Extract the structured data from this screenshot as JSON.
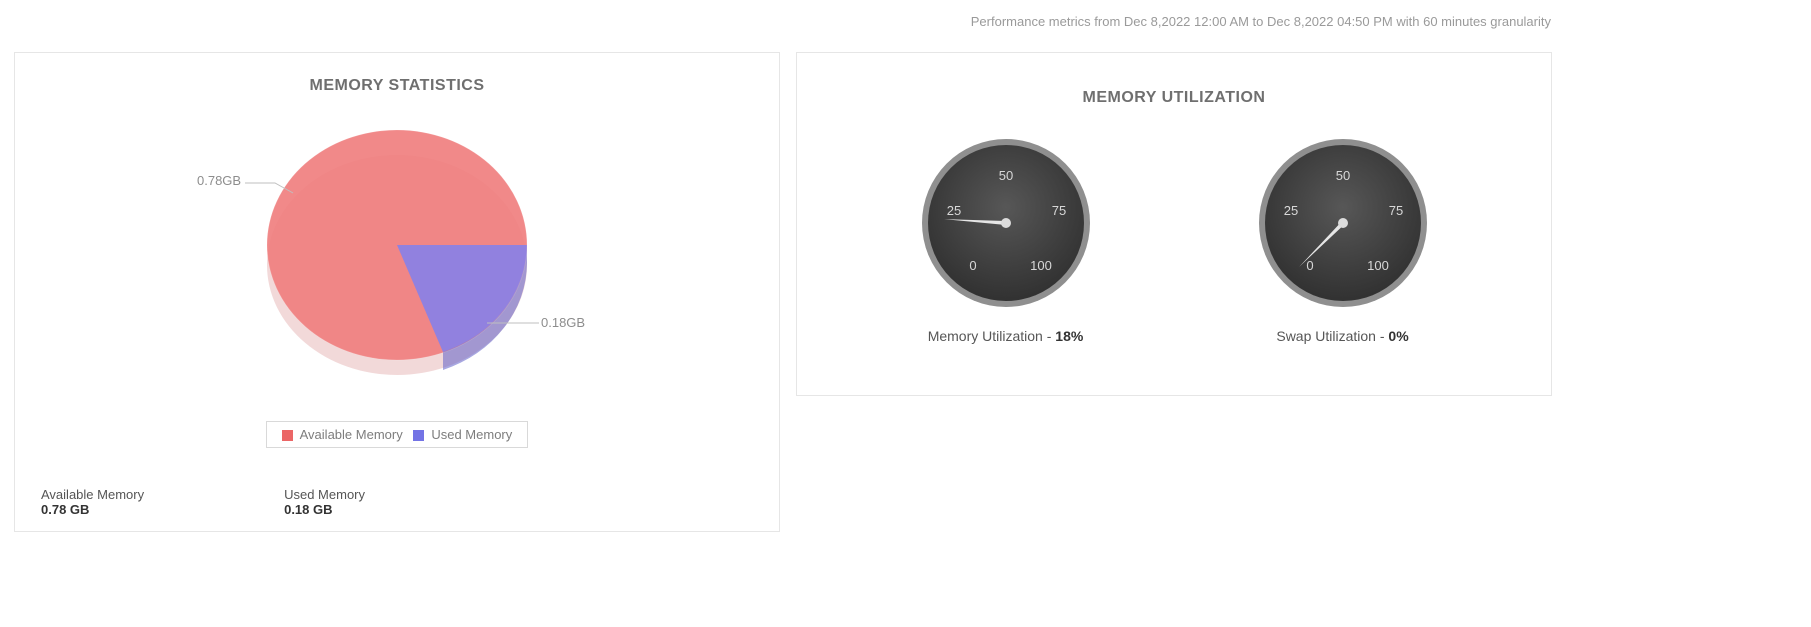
{
  "header": {
    "metrics_line": "Performance metrics from Dec 8,2022 12:00 AM to Dec 8,2022 04:50 PM with 60 minutes granularity"
  },
  "memory_statistics": {
    "title": "MEMORY STATISTICS",
    "available_label": "Available Memory",
    "used_label": "Used Memory",
    "available_value": "0.78 GB",
    "used_value": "0.18 GB",
    "pie": {
      "available_slice_label": "0.78GB",
      "used_slice_label": "0.18GB"
    },
    "legend": {
      "available": "Available Memory",
      "used": "Used Memory"
    }
  },
  "memory_utilization": {
    "title": "MEMORY UTILIZATION",
    "mem_label_prefix": "Memory Utilization - ",
    "mem_value_display": "18%",
    "swap_label_prefix": "Swap Utilization - ",
    "swap_value_display": "0%",
    "gauge_ticks": {
      "t0": "0",
      "t25": "25",
      "t50": "50",
      "t75": "75",
      "t100": "100"
    }
  },
  "chart_data": [
    {
      "type": "pie",
      "title": "MEMORY STATISTICS",
      "series": [
        {
          "name": "Available Memory",
          "value": 0.78,
          "unit": "GB",
          "color": "#ef7c7c"
        },
        {
          "name": "Used Memory",
          "value": 0.18,
          "unit": "GB",
          "color": "#8080ef"
        }
      ],
      "legend_position": "bottom"
    },
    {
      "type": "gauge",
      "title": "Memory Utilization",
      "value": 18,
      "range": [
        0,
        100
      ],
      "ticks": [
        0,
        25,
        50,
        75,
        100
      ],
      "unit": "%"
    },
    {
      "type": "gauge",
      "title": "Swap Utilization",
      "value": 0,
      "range": [
        0,
        100
      ],
      "ticks": [
        0,
        25,
        50,
        75,
        100
      ],
      "unit": "%"
    }
  ]
}
